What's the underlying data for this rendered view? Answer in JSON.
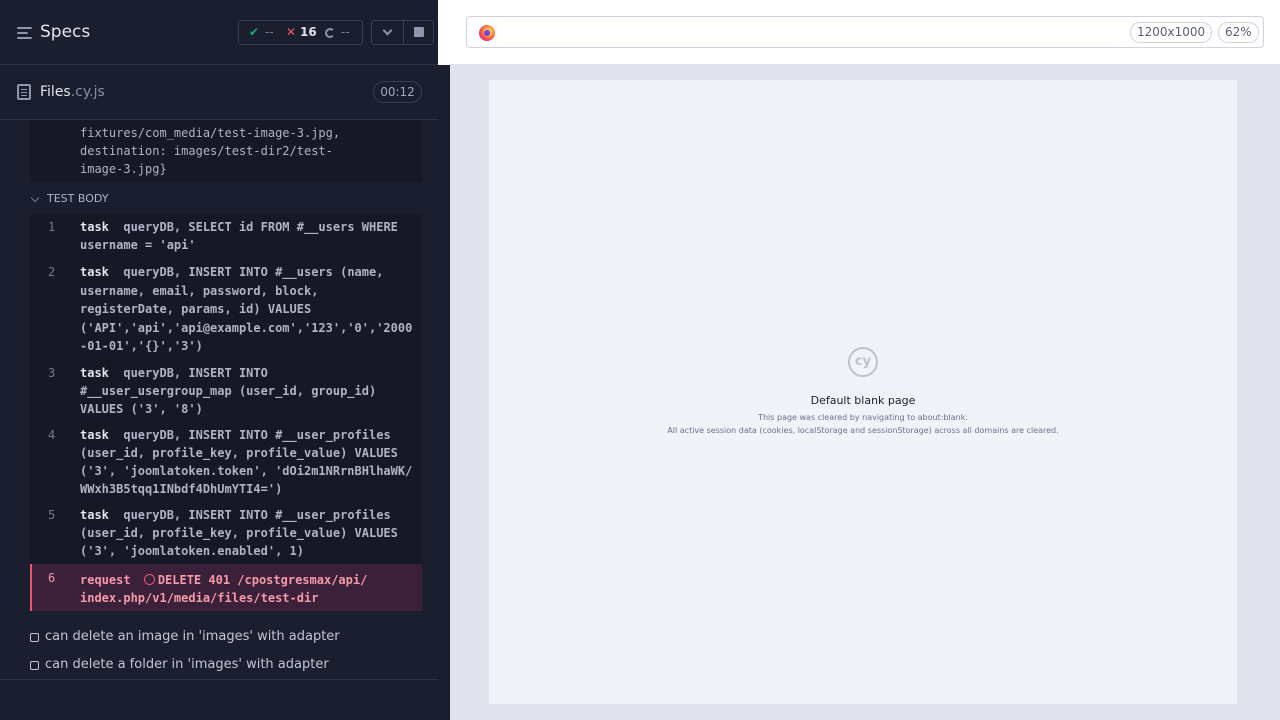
{
  "header": {
    "title": "Specs",
    "stats": {
      "passed": "--",
      "failed": "16",
      "pending": "--"
    }
  },
  "file": {
    "name": "Files",
    "ext": ".cy.js",
    "duration": "00:12"
  },
  "reporter": {
    "before_block": "fixtures/com_media/test-image-3.jpg,\ndestination: images/test-dir2/test-\nimage-3.jpg}",
    "section": "TEST BODY",
    "commands": [
      {
        "num": "1",
        "name": "task",
        "message": "queryDB, SELECT id FROM #__users WHERE\nusername = 'api'"
      },
      {
        "num": "2",
        "name": "task",
        "message": "queryDB, INSERT INTO #__users (name,\nusername, email, password, block,\nregisterDate, params, id) VALUES\n('API','api','api@example.com','123','0','2000\n-01-01','{}','3')"
      },
      {
        "num": "3",
        "name": "task",
        "message": "queryDB, INSERT INTO\n#__user_usergroup_map (user_id, group_id)\nVALUES ('3', '8')"
      },
      {
        "num": "4",
        "name": "task",
        "message": "queryDB, INSERT INTO #__user_profiles\n(user_id, profile_key, profile_value) VALUES\n('3', 'joomlatoken.token', 'dOi2m1NRrnBHlhaWK/\nWWxh3B5tqq1INbdf4DhUmYTI4=')"
      },
      {
        "num": "5",
        "name": "task",
        "message": "queryDB, INSERT INTO #__user_profiles\n(user_id, profile_key, profile_value) VALUES\n('3', 'joomlatoken.enabled', 1)"
      },
      {
        "num": "6",
        "name": "request",
        "message": "DELETE 401 /cpostgresmax/api/\nindex.php/v1/media/files/test-dir"
      }
    ],
    "tests": [
      "can delete an image in 'images' with adapter",
      "can delete a folder in 'images' with adapter"
    ]
  },
  "browser": {
    "viewport": "1200x1000",
    "zoom": "62%",
    "logo_text": "cy",
    "blank_title": "Default blank page",
    "blank_line1": "This page was cleared by navigating to about:blank.",
    "blank_line2": "All active session data (cookies, localStorage and sessionStorage) across all domains are cleared."
  },
  "colors": {
    "passed": "#1fa971",
    "failed": "#f15966",
    "error_bg": "#3a2139",
    "error_text": "#f59aa9"
  }
}
